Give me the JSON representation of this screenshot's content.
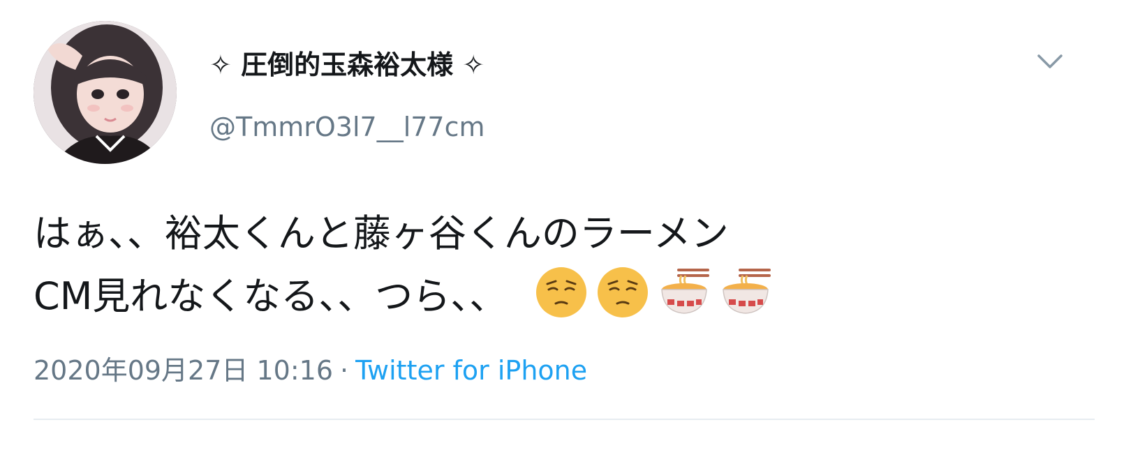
{
  "tweet": {
    "display_name": "✧ 圧倒的玉森裕太様 ✧",
    "handle": "@TmmrO3l7__l77cm",
    "text_line1": "はぁ、、裕太くんと藤ヶ谷くんのラーメン",
    "text_line2": "CM見れなくなる、、つら、、",
    "emojis": [
      "pensive-face",
      "pensive-face",
      "ramen-bowl",
      "ramen-bowl"
    ],
    "date": "2020年09月27日 10:16",
    "separator": "·",
    "source": "Twitter for iPhone"
  },
  "colors": {
    "text": "#14171a",
    "secondary": "#657786",
    "link": "#1da1f2",
    "divider": "#e6ecf0"
  }
}
